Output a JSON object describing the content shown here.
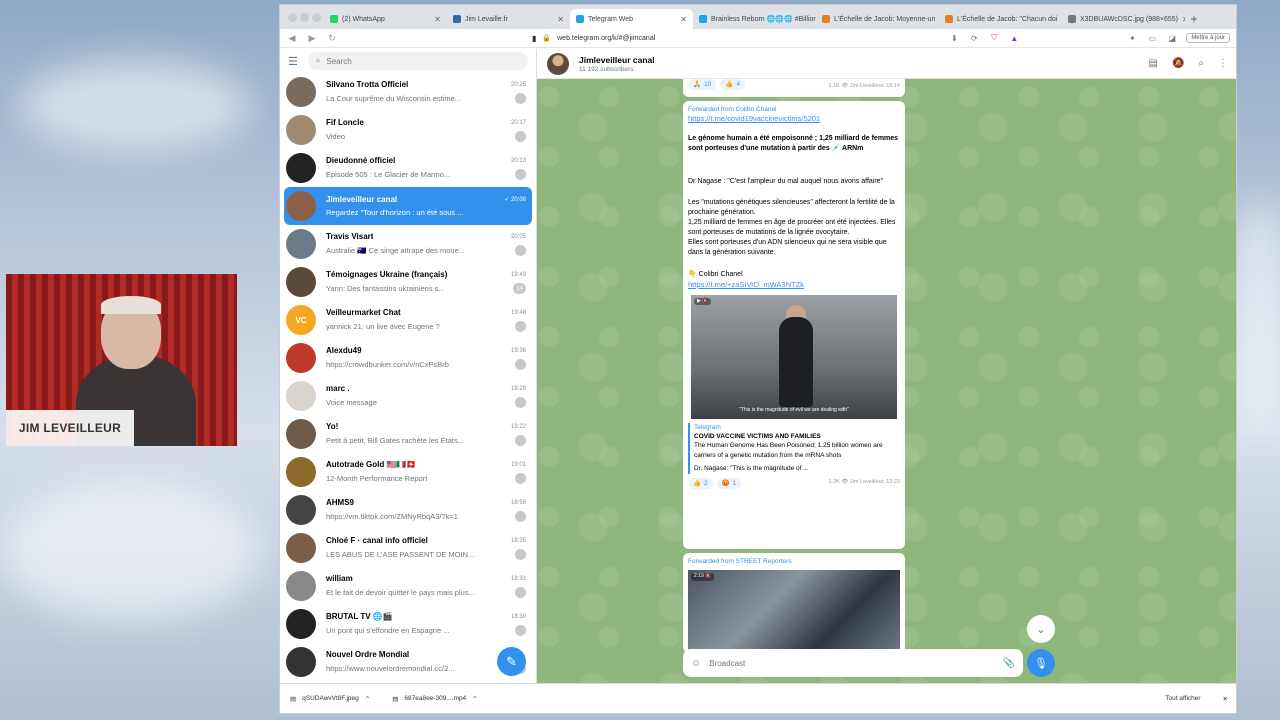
{
  "browser": {
    "tabs": [
      {
        "label": "(2) WhatsApp",
        "color": "#25d366"
      },
      {
        "label": "Jim Levaille.fr",
        "color": "#2b6cb0"
      },
      {
        "label": "Telegram Web",
        "color": "#2aa3e0",
        "active": true
      },
      {
        "label": "Brainless Reborn 🌐🌐🌐 #Billion",
        "color": "#1da1f2"
      },
      {
        "label": "L'Échelle de Jacob: Moyenne-un",
        "color": "#e67e22"
      },
      {
        "label": "L'Échelle de Jacob: \"Chacun doi",
        "color": "#e67e22"
      },
      {
        "label": "X3DBUAWcDSC.jpg (988×655)",
        "color": "#777"
      }
    ],
    "new_tab": "+",
    "url": "web.telegram.org/k/#@jimcanal",
    "update_button": "Mettre à jour",
    "downloads": [
      {
        "name": "qSUDAwvVt8F.jpeg"
      },
      {
        "name": "687ea8ee-309....mp4"
      }
    ],
    "show_all": "Tout afficher",
    "close": "✕"
  },
  "sidebar": {
    "search_placeholder": "Search",
    "chats": [
      {
        "name": "Silvano Trotta Officiel",
        "time": "20:25",
        "preview": "La Cour suprême du Wisconsin estime...",
        "badge": "",
        "avatar": "#7a6a5c"
      },
      {
        "name": "Fif Loncle",
        "time": "20:17",
        "preview": "Video",
        "badge": "",
        "avatar": "#a08a74"
      },
      {
        "name": "Dieudonné officiel",
        "time": "20:13",
        "preview": "Episode 505 : Le Glacier de Marmo...",
        "badge": "",
        "avatar": "#222"
      },
      {
        "name": "Jimleveilleur canal",
        "time": "✓ 20:08",
        "preview": "Regardez \"Tour d'horizon : un été sous ...",
        "badge": "",
        "avatar": "#8a6046",
        "active": true
      },
      {
        "name": "Travis Visart",
        "time": "20:05",
        "preview": "Australie 🇦🇺 Ce singe attrape des moue...",
        "badge": "",
        "avatar": "#6b7a88"
      },
      {
        "name": "Témoignages Ukraine (français)",
        "time": "19:49",
        "preview": "Yann: Des fantassins ukrainiens s...",
        "badge": "14",
        "avatar": "#5a4a3a"
      },
      {
        "name": "Veilleurmarket Chat",
        "time": "19:48",
        "preview": "yannick 21: un live avec Eugene ?",
        "badge": "",
        "avatar": "#f5a623",
        "initials": "VC"
      },
      {
        "name": "Alexdu49",
        "time": "19:36",
        "preview": "https://crowdbunker.com/v/nCxPsBrb",
        "badge": "",
        "avatar": "#c0392b"
      },
      {
        "name": "marc .",
        "time": "19:29",
        "preview": "Voice message",
        "badge": "",
        "avatar": "#d8d3cc"
      },
      {
        "name": "Yo!",
        "time": "19:22",
        "preview": "Petit à petit, Bill Gates rachète les États...",
        "badge": "",
        "avatar": "#6d5a4b"
      },
      {
        "name": "Autotrade Gold 🇺🇸🇮🇹🇨🇭",
        "time": "19:01",
        "preview": "12-Month Performance Report",
        "badge": "",
        "avatar": "#8b6a2b"
      },
      {
        "name": "AHMS9",
        "time": "18:58",
        "preview": "https://vm.tiktok.com/ZMNyRbqA3/?k=1",
        "badge": "",
        "avatar": "#444"
      },
      {
        "name": "Chloé F · canal info officiel",
        "time": "18:35",
        "preview": "LES ABUS DE L'ASE PASSENT DE MOIN...",
        "badge": "",
        "avatar": "#7b5e48"
      },
      {
        "name": "william",
        "time": "18:31",
        "preview": "Et le fait de devoir quitter le pays mais plus...",
        "badge": "",
        "avatar": "#888"
      },
      {
        "name": "BRUTAL TV 🌐🎬",
        "time": "18:30",
        "preview": "Un pont qui s'effondre en Espagne ...",
        "badge": "",
        "avatar": "#222"
      },
      {
        "name": "Nouvel Ordre Mondial",
        "time": "",
        "preview": "https://www.nouvelordremondial.cc/2...",
        "badge": "",
        "avatar": "#333"
      }
    ]
  },
  "header": {
    "title": "Jimleveilleur canal",
    "subtitle": "11 192 subscribers"
  },
  "messages": {
    "top_reactions": [
      {
        "emoji": "🙏",
        "count": "10"
      },
      {
        "emoji": "👍",
        "count": "4"
      }
    ],
    "top_meta": "1.1K 👁 Jim Leveilleur, 19:14",
    "post1": {
      "forwarded": "Forwarded from Colibri Chanel",
      "link1": "https://t.me/covid19vaccinevictims/5201",
      "headline": "Le génome humain a été empoisonné ; 1,25 milliard de femmes sont porteuses d'une mutation à partir des 💉 ARNm",
      "p1": "Dr Nagase : \"C'est l'ampleur du mal auquel nous avons affaire\"",
      "p2": "Les \"mutations génétiques silencieuses\" affecteront la fertilité de la prochaine génération.",
      "p3": "1,25 milliard de femmes en âge de procréer ont été injectées. Elles sont porteuses de mutations de la lignée ovocytaire.",
      "p4": "Elles sont porteuses d'un ADN silencieux qui ne sera visible que dans la génération suivante.",
      "signature": "👇 Colibri Chanel",
      "link2": "https://t.me/+zaSIVrD_mWA3NTZk",
      "video_caption": "\"This is the magnitude of evil we are dealing with\"",
      "preview_source": "Telegram",
      "preview_title": "COVID VACCINE VICTIMS AND FAMILIES",
      "preview_text": "The Human Genome Has Been Poisoned; 1.25 billion women are carriers of a genetic mutation from the mRNA shots",
      "preview_more": "Dr. Nagase: \"This is the magnitude of ...",
      "reactions": [
        {
          "emoji": "👍",
          "count": "2"
        },
        {
          "emoji": "😡",
          "count": "1"
        }
      ],
      "meta": "1.2K 👁 Jim Leveilleur, 13:23"
    },
    "post2": {
      "forwarded": "Forwarded from STREET Reporters",
      "duration": "2:19 🔇"
    }
  },
  "composer": {
    "placeholder": "Broadcast"
  },
  "webcam": {
    "label": "JIM LEVEILLEUR"
  }
}
